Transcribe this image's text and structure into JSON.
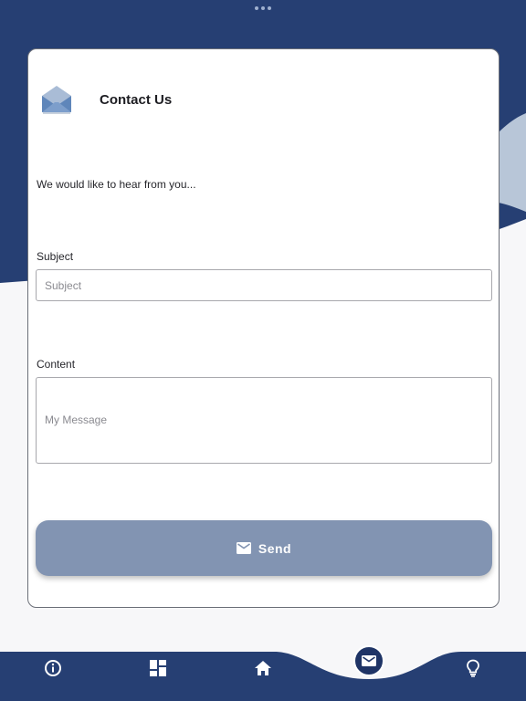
{
  "colors": {
    "navy": "#263f73",
    "light_band": "#b8c6d8",
    "send_button": "#8294b2",
    "card_background": "#ffffff"
  },
  "header": {
    "icon": "envelope-icon",
    "title": "Contact Us"
  },
  "intro_text": "We would like to hear from you...",
  "form": {
    "subject": {
      "label": "Subject",
      "placeholder": "Subject",
      "value": ""
    },
    "content": {
      "label": "Content",
      "placeholder": "My Message",
      "value": ""
    },
    "send_button": {
      "icon": "mail-icon",
      "label": "Send"
    }
  },
  "bottom_nav": {
    "items": [
      {
        "name": "info",
        "icon": "info-icon",
        "active": false
      },
      {
        "name": "dashboard",
        "icon": "dashboard-icon",
        "active": false
      },
      {
        "name": "home",
        "icon": "home-icon",
        "active": false
      },
      {
        "name": "contact",
        "icon": "mail-icon",
        "active": true
      },
      {
        "name": "ideas",
        "icon": "lightbulb-icon",
        "active": false
      }
    ]
  }
}
